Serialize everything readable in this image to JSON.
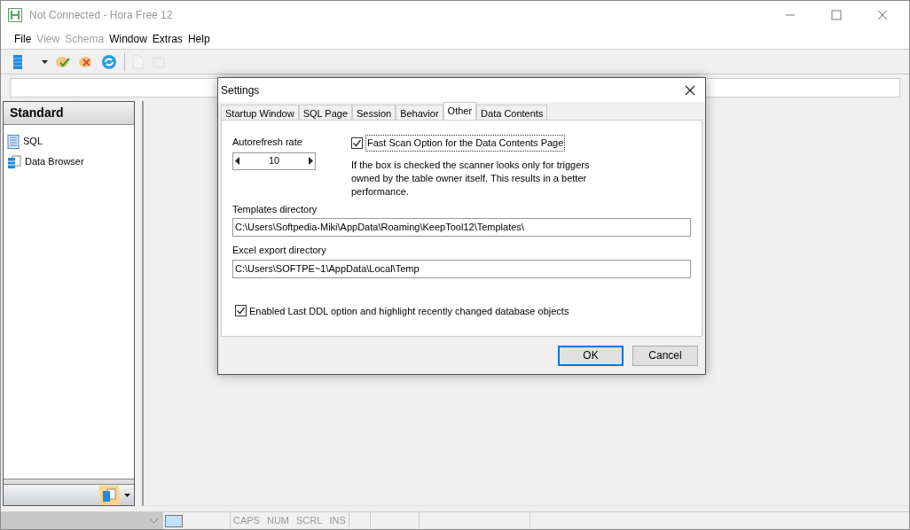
{
  "window": {
    "title": "Not Connected - Hora Free 12"
  },
  "menu": [
    {
      "label": "File",
      "disabled": false
    },
    {
      "label": "View",
      "disabled": true
    },
    {
      "label": "Schema",
      "disabled": true
    },
    {
      "label": "Window",
      "disabled": false
    },
    {
      "label": "Extras",
      "disabled": false
    },
    {
      "label": "Help",
      "disabled": false
    }
  ],
  "sidebar": {
    "title": "Standard",
    "items": [
      {
        "label": "SQL",
        "kind": "sql"
      },
      {
        "label": "Data Browser",
        "kind": "browser"
      }
    ]
  },
  "dialog": {
    "title": "Settings",
    "tabs": [
      {
        "label": "Startup Window",
        "selected": false
      },
      {
        "label": "SQL Page",
        "selected": false
      },
      {
        "label": "Session",
        "selected": false
      },
      {
        "label": "Behavior",
        "selected": false
      },
      {
        "label": "Other",
        "selected": true
      },
      {
        "label": "Data Contents",
        "selected": false
      }
    ],
    "autorefresh": {
      "label": "Autorefresh rate",
      "value": "10"
    },
    "fast_scan": {
      "label": "Fast Scan Option for the Data Contents Page",
      "checked": true
    },
    "fast_scan_note": "If the box is checked the scanner looks only for triggers owned by the table owner itself. This results in a better performance.",
    "templates": {
      "label": "Templates directory",
      "value": "C:\\Users\\Softpedia-Miki\\AppData\\Roaming\\KeepTool12\\Templates\\"
    },
    "excel": {
      "label": "Excel export directory",
      "value": "C:\\Users\\SOFTPE~1\\AppData\\Local\\Temp"
    },
    "last_ddl": {
      "label": "Enabled Last DDL option and highlight recently changed database objects",
      "checked": true
    },
    "buttons": [
      "OK",
      "Cancel"
    ]
  },
  "status_bar": [
    "CAPS",
    "NUM",
    "SCRL",
    "INS"
  ]
}
